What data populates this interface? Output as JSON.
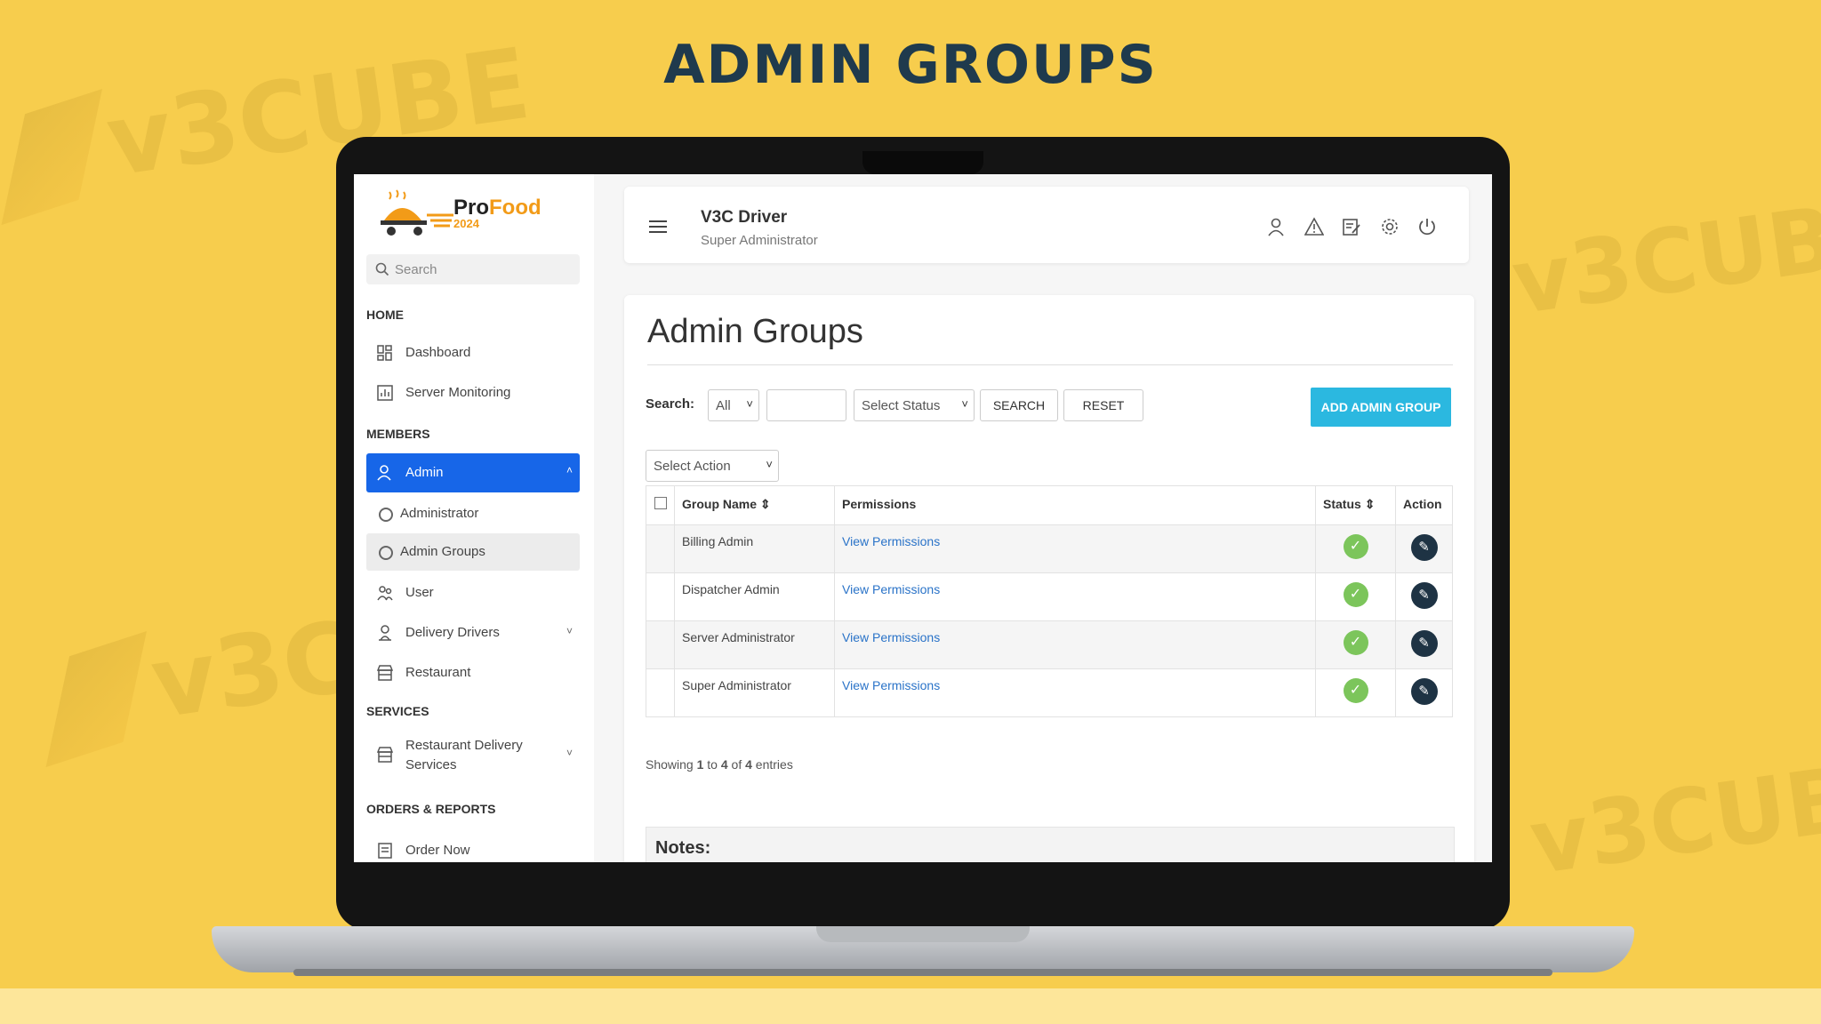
{
  "heading": "ADMIN GROUPS",
  "watermark": {
    "brand": "v3CUBE",
    "sub": "v.3"
  },
  "brand": {
    "pro": "Pro",
    "food": "Food",
    "year": "2024"
  },
  "sidebar": {
    "search_placeholder": "Search",
    "sections": {
      "home": "HOME",
      "members": "MEMBERS",
      "services": "SERVICES",
      "orders": "ORDERS & REPORTS"
    },
    "items": {
      "dashboard": "Dashboard",
      "server_monitoring": "Server Monitoring",
      "admin": "Admin",
      "administrator": "Administrator",
      "admin_groups": "Admin Groups",
      "user": "User",
      "delivery_drivers": "Delivery Drivers",
      "restaurant": "Restaurant",
      "restaurant_delivery_1": "Restaurant Delivery",
      "restaurant_delivery_2": "Services",
      "order_now": "Order Now"
    }
  },
  "header": {
    "name": "V3C Driver",
    "role": "Super Administrator"
  },
  "main": {
    "title": "Admin Groups",
    "search_label": "Search:",
    "filter_all": "All",
    "status_select": "Select Status",
    "search_btn": "SEARCH",
    "reset_btn": "RESET",
    "add_btn": "ADD ADMIN GROUP",
    "action_select": "Select Action",
    "columns": {
      "group": "Group Name",
      "perm": "Permissions",
      "status": "Status",
      "action": "Action"
    },
    "rows": [
      {
        "name": "Billing Admin",
        "perm": "View Permissions"
      },
      {
        "name": "Dispatcher Admin",
        "perm": "View Permissions"
      },
      {
        "name": "Server Administrator",
        "perm": "View Permissions"
      },
      {
        "name": "Super Administrator",
        "perm": "View Permissions"
      }
    ],
    "showing": {
      "pre": "Showing ",
      "from": "1",
      "to_word": " to ",
      "to": "4",
      "of_word": " of ",
      "total": "4",
      "post": " entries"
    },
    "notes": "Notes:"
  },
  "colors": {
    "background": "#f7cd4d",
    "heading": "#1f3a4d",
    "active": "#1766e8",
    "add_button": "#2bb8e0",
    "status_ok": "#7cc55b"
  }
}
